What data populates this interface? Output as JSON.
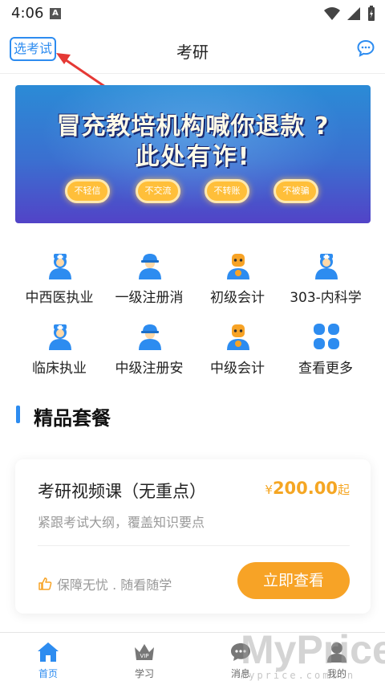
{
  "status_bar": {
    "time": "4:06",
    "notif_letter": "A"
  },
  "header": {
    "exam_select_label": "选考试",
    "title": "考研",
    "chat_icon": "chat-bubble-icon"
  },
  "banner": {
    "line1": "冒充教培机构喊你退款 ?",
    "line2": "此处有诈!",
    "pills": [
      "不轻信",
      "不交流",
      "不转账",
      "不被骗"
    ]
  },
  "categories": [
    {
      "label": "中西医执业",
      "icon": "doctor-icon"
    },
    {
      "label": "一级注册消",
      "icon": "worker-icon"
    },
    {
      "label": "初级会计",
      "icon": "accountant-icon"
    },
    {
      "label": "303-内科学",
      "icon": "doctor-icon"
    },
    {
      "label": "临床执业",
      "icon": "doctor-icon"
    },
    {
      "label": "中级注册安",
      "icon": "worker-icon"
    },
    {
      "label": "中级会计",
      "icon": "accountant-icon"
    },
    {
      "label": "查看更多",
      "icon": "grid-more-icon"
    }
  ],
  "section": {
    "title": "精品套餐"
  },
  "package": {
    "title": "考研视频课（无重点）",
    "price_symbol": "¥",
    "price": "200.00",
    "price_suffix": "起",
    "subtitle": "紧跟考试大纲，覆盖知识要点",
    "guarantee": "保障无忧 . 随看随学",
    "button": "立即查看"
  },
  "tabs": [
    {
      "label": "首页",
      "active": true
    },
    {
      "label": "学习",
      "active": false
    },
    {
      "label": "消息",
      "active": false
    },
    {
      "label": "我的",
      "active": false
    }
  ],
  "watermark": {
    "text": "MyPrice",
    "sub": "myprice.com.cn"
  },
  "colors": {
    "accent": "#2d8cf0",
    "orange": "#f7a326",
    "price": "#f5a623"
  }
}
